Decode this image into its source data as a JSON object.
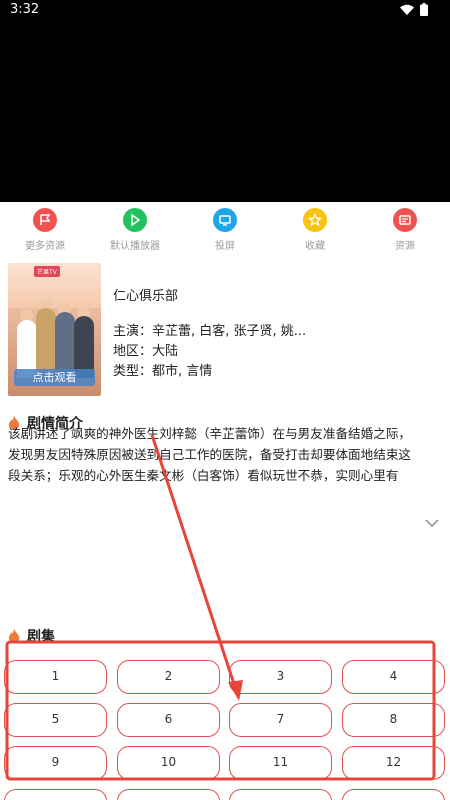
{
  "status_bar": {
    "time": "3:32"
  },
  "actions": [
    {
      "label": "更多资源",
      "icon": "flag-icon",
      "color": "#f0524f"
    },
    {
      "label": "默认播放器",
      "icon": "play-icon",
      "color": "#22c35e"
    },
    {
      "label": "投屏",
      "icon": "cast-icon",
      "color": "#1ea6e8"
    },
    {
      "label": "收藏",
      "icon": "star-icon",
      "color": "#f7c412"
    },
    {
      "label": "资源",
      "icon": "resource-icon",
      "color": "#f0524f"
    }
  ],
  "poster": {
    "play_label": "点击观看",
    "logo_text": "芒果TV"
  },
  "show": {
    "title": "仁心俱乐部",
    "cast": "主演：辛芷蕾, 白客, 张子贤, 姚...",
    "region": "地区：大陆",
    "genre": "类型：都市, 言情"
  },
  "synopsis": {
    "heading": "剧情简介",
    "lines": [
      "该剧讲述了飒爽的神外医生刘梓懿（辛芷蕾饰）在与男友准备结婚之际，",
      "发现男友因特殊原因被送到自己工作的医院，备受打击却要体面地结束这",
      "段关系；乐观的心外医生秦文彬（白客饰）看似玩世不恭，实则心里有"
    ]
  },
  "episodes": {
    "heading": "剧集",
    "items": [
      "1",
      "2",
      "3",
      "4",
      "5",
      "6",
      "7",
      "8",
      "9",
      "10",
      "11",
      "12"
    ]
  },
  "colors": {
    "accent": "#e15050",
    "flame": "#f07a3a",
    "annotation": "#e8443a"
  }
}
